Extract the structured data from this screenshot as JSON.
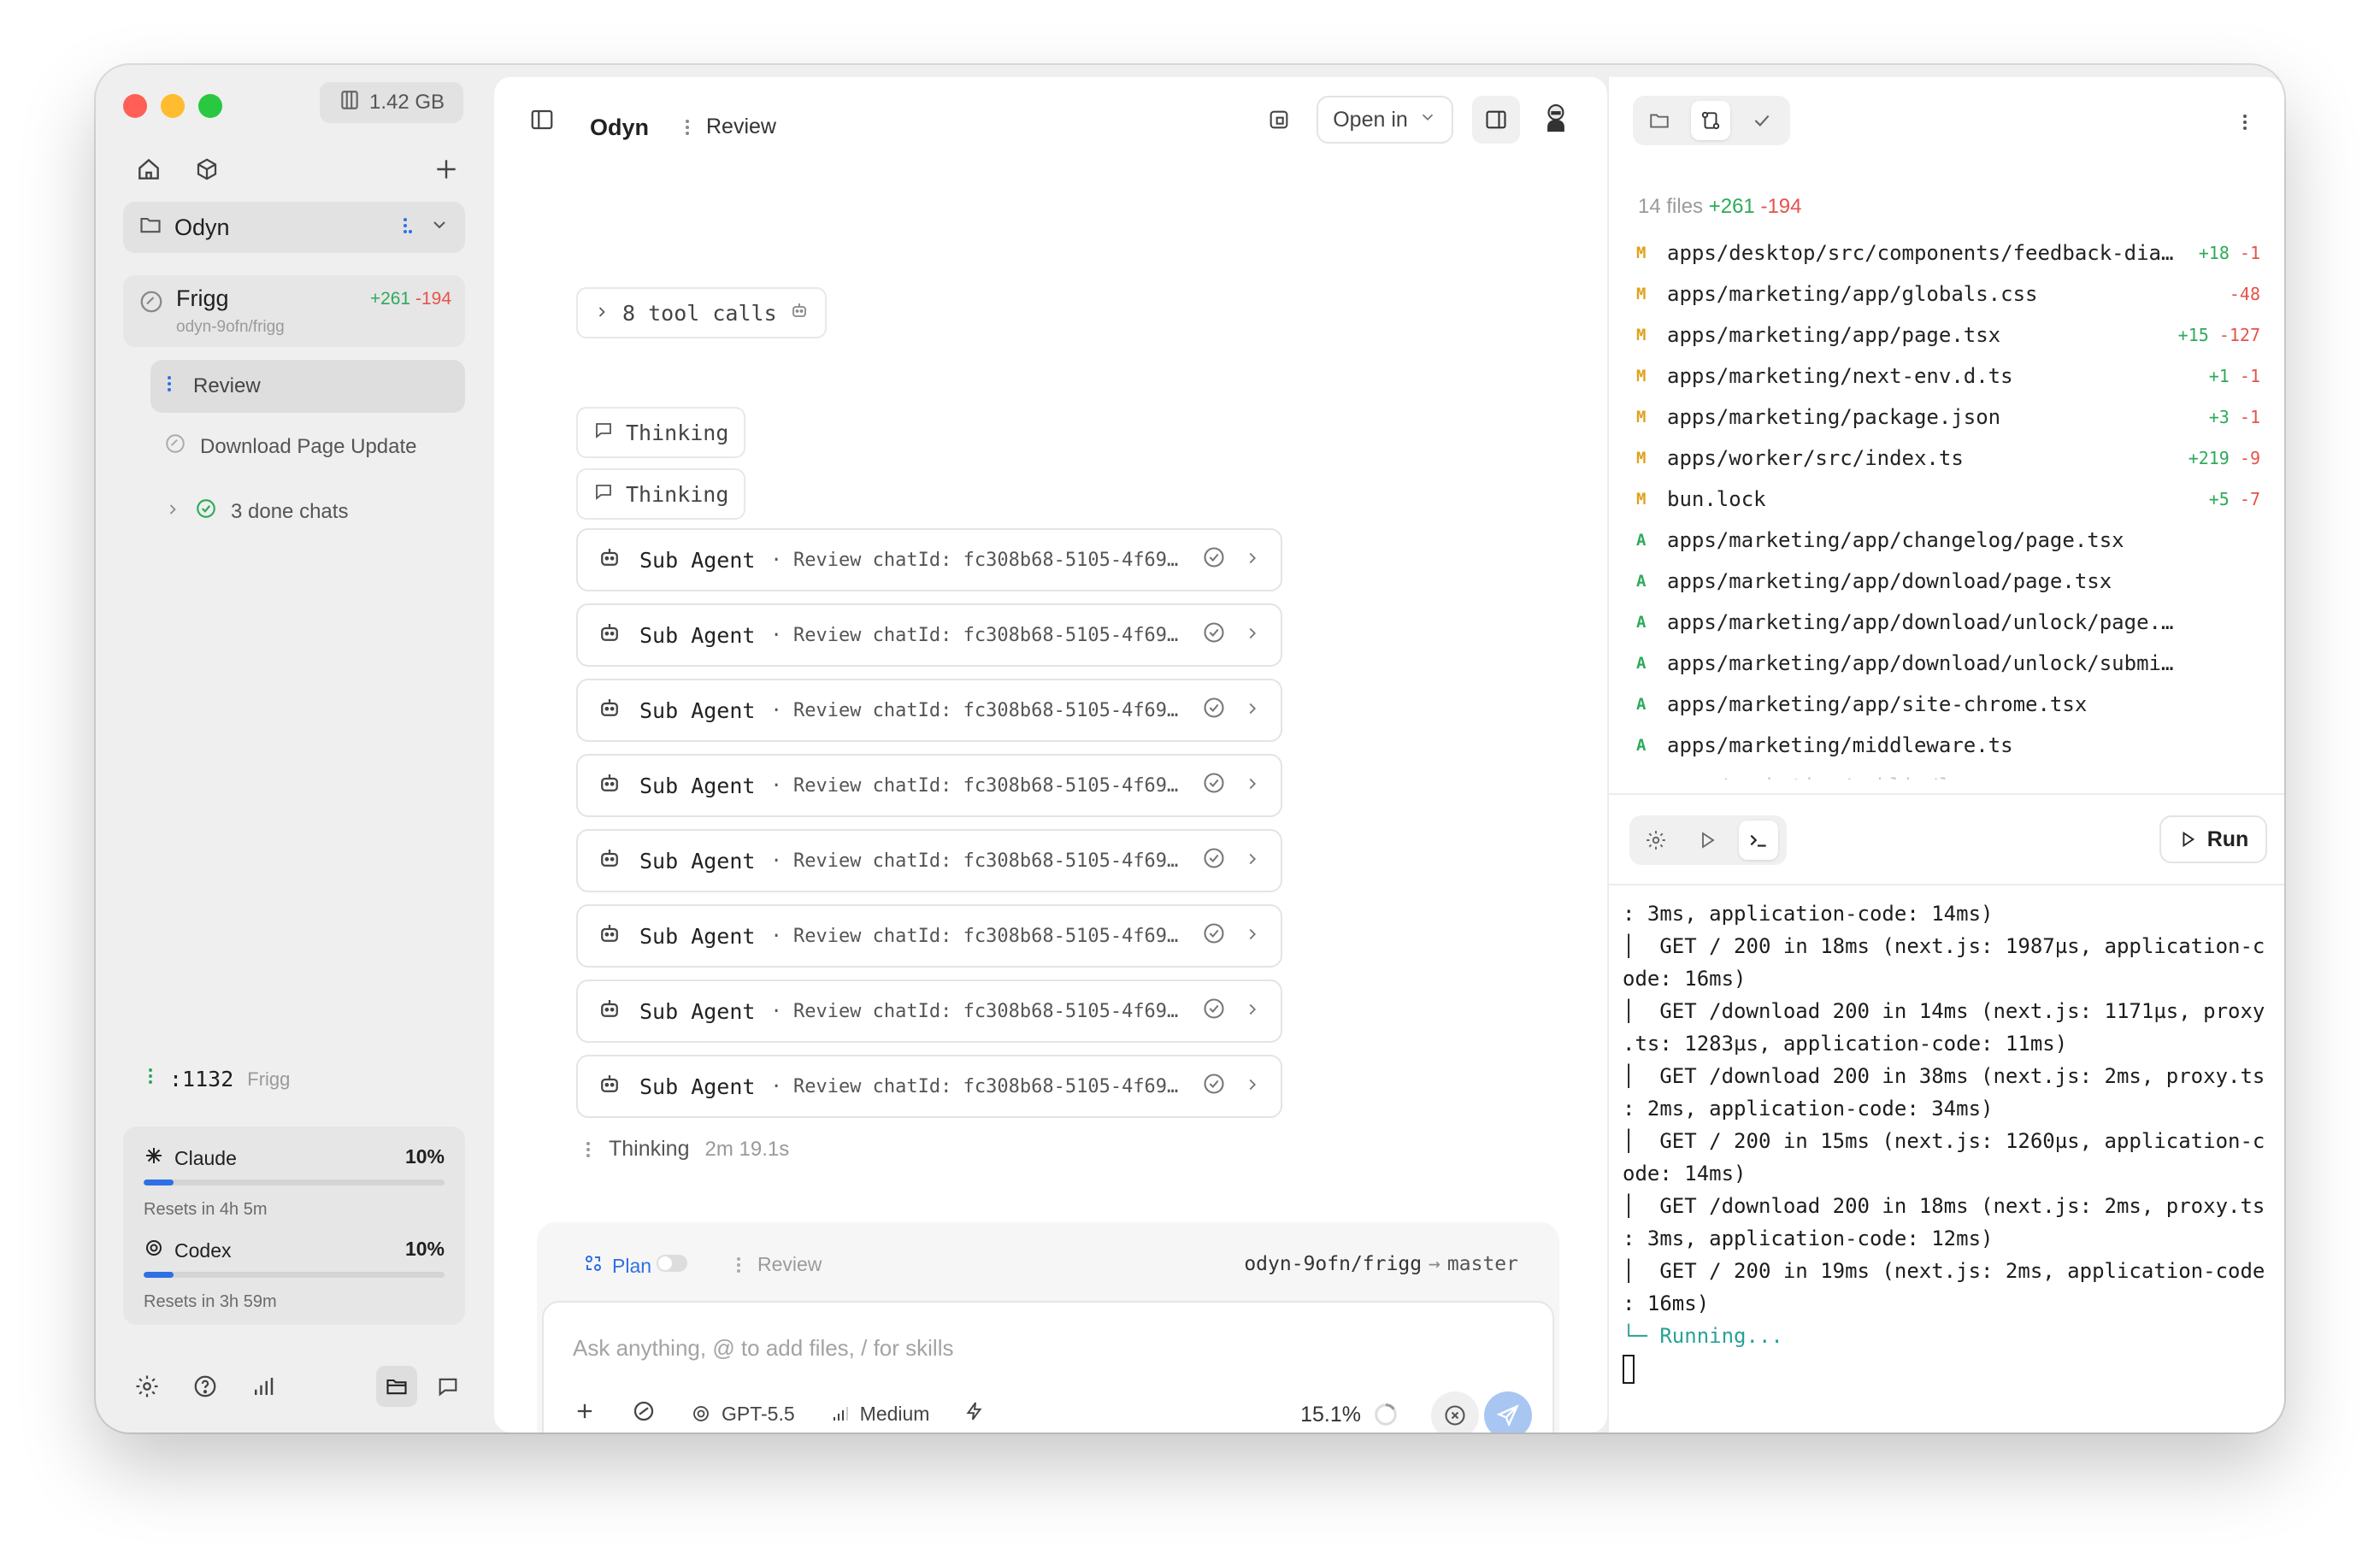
{
  "sidebar": {
    "memory": "1.42 GB",
    "project": "Odyn",
    "chat": {
      "title": "Frigg",
      "branch": "odyn-9ofn/frigg",
      "additions": "+261",
      "deletions": "-194"
    },
    "subchats": [
      {
        "label": "Review"
      },
      {
        "label": "Download Page Update"
      }
    ],
    "done_chats": "3 done chats",
    "port": ":1132",
    "port_label": "Frigg",
    "usage": [
      {
        "name": "Claude",
        "percent": "10%",
        "fill": 0.1,
        "reset": "Resets in 4h 5m"
      },
      {
        "name": "Codex",
        "percent": "10%",
        "fill": 0.1,
        "reset": "Resets in 3h 59m"
      }
    ]
  },
  "chat": {
    "project": "Odyn",
    "tab": "Review",
    "open_in": "Open in",
    "tool_calls": "8 tool calls",
    "thinking_blocks": [
      "Thinking",
      "Thinking"
    ],
    "sub_agents": [
      {
        "name": "Sub Agent",
        "desc": "· Review chatId: fc308b68-5105-4f69…"
      },
      {
        "name": "Sub Agent",
        "desc": "· Review chatId: fc308b68-5105-4f69…"
      },
      {
        "name": "Sub Agent",
        "desc": "· Review chatId: fc308b68-5105-4f69…"
      },
      {
        "name": "Sub Agent",
        "desc": "· Review chatId: fc308b68-5105-4f69…"
      },
      {
        "name": "Sub Agent",
        "desc": "· Review chatId: fc308b68-5105-4f69…"
      },
      {
        "name": "Sub Agent",
        "desc": "· Review chatId: fc308b68-5105-4f69…"
      },
      {
        "name": "Sub Agent",
        "desc": "· Review chatId: fc308b68-5105-4f69…"
      },
      {
        "name": "Sub Agent",
        "desc": "· Review chatId: fc308b68-5105-4f69…"
      }
    ],
    "thinking_live": "Thinking",
    "thinking_time": "2m 19.1s"
  },
  "composer": {
    "plan": "Plan",
    "review": "Review",
    "branch": "odyn-9ofn/frigg",
    "target": "master",
    "placeholder": "Ask anything, @ to add files, / for skills",
    "model": "GPT-5.5",
    "effort": "Medium",
    "context": "15.1%"
  },
  "changes": {
    "summary_files": "14 files",
    "summary_add": "+261",
    "summary_del": "-194",
    "files": [
      {
        "status": "M",
        "path": "apps/desktop/src/components/feedback-dia…",
        "add": "+18",
        "del": "-1"
      },
      {
        "status": "M",
        "path": "apps/marketing/app/globals.css",
        "add": "",
        "del": "-48"
      },
      {
        "status": "M",
        "path": "apps/marketing/app/page.tsx",
        "add": "+15",
        "del": "-127"
      },
      {
        "status": "M",
        "path": "apps/marketing/next-env.d.ts",
        "add": "+1",
        "del": "-1"
      },
      {
        "status": "M",
        "path": "apps/marketing/package.json",
        "add": "+3",
        "del": "-1"
      },
      {
        "status": "M",
        "path": "apps/worker/src/index.ts",
        "add": "+219",
        "del": "-9"
      },
      {
        "status": "M",
        "path": "bun.lock",
        "add": "+5",
        "del": "-7"
      },
      {
        "status": "A",
        "path": "apps/marketing/app/changelog/page.tsx",
        "add": "",
        "del": ""
      },
      {
        "status": "A",
        "path": "apps/marketing/app/download/page.tsx",
        "add": "",
        "del": ""
      },
      {
        "status": "A",
        "path": "apps/marketing/app/download/unlock/page.tsx",
        "add": "",
        "del": ""
      },
      {
        "status": "A",
        "path": "apps/marketing/app/download/unlock/submit/rou…",
        "add": "",
        "del": ""
      },
      {
        "status": "A",
        "path": "apps/marketing/app/site-chrome.tsx",
        "add": "",
        "del": ""
      },
      {
        "status": "A",
        "path": "apps/marketing/middleware.ts",
        "add": "",
        "del": ""
      },
      {
        "status": "A",
        "path": "apps/marketing/public/logo.png",
        "add": "",
        "del": ""
      }
    ]
  },
  "terminal": {
    "run": "Run",
    "lines": [
      ": 3ms, application-code: 14ms)",
      "│  GET / 200 in 18ms (next.js: 1987µs, application-c",
      "ode: 16ms)",
      "│  GET /download 200 in 14ms (next.js: 1171µs, proxy",
      ".ts: 1283µs, application-code: 11ms)",
      "│  GET /download 200 in 38ms (next.js: 2ms, proxy.ts",
      ": 2ms, application-code: 34ms)",
      "│  GET / 200 in 15ms (next.js: 1260µs, application-c",
      "ode: 14ms)",
      "│  GET /download 200 in 18ms (next.js: 2ms, proxy.ts",
      ": 3ms, application-code: 12ms)",
      "│  GET / 200 in 19ms (next.js: 2ms, application-code",
      ": 16ms)"
    ],
    "status": "└─ Running..."
  },
  "colors": {
    "accent": "#2f6fe6",
    "add": "#2eaa5a",
    "del": "#e5534b",
    "modified": "#e0a21c"
  }
}
